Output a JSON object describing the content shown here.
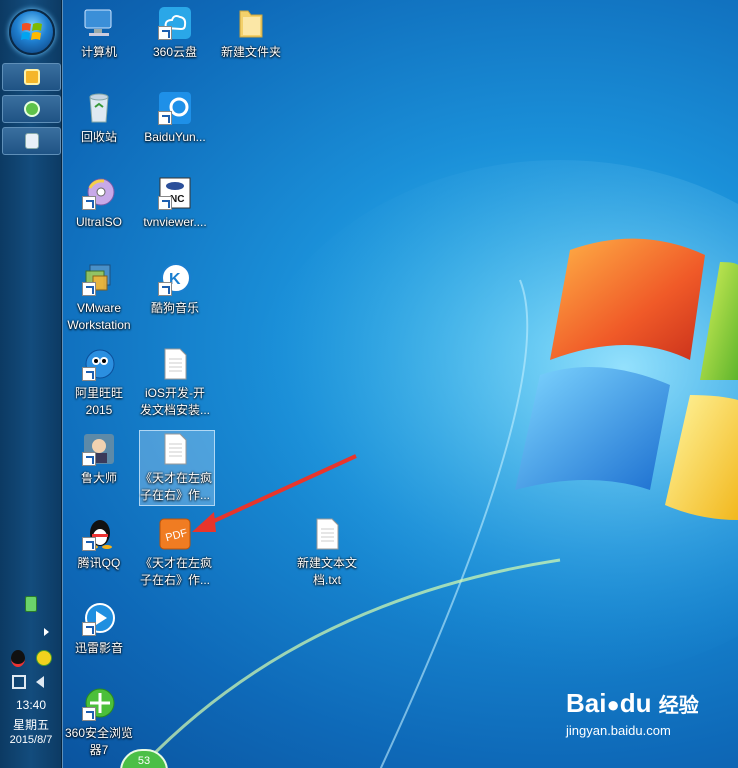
{
  "desktop": {
    "icons": [
      {
        "label": "计算机",
        "icon": "computer-icon"
      },
      {
        "label": "360云盘",
        "icon": "cloud-drive-icon"
      },
      {
        "label": "新建文件夹",
        "icon": "folder-icon"
      },
      {
        "label": "回收站",
        "icon": "recycle-bin-icon"
      },
      {
        "label": "BaiduYun...",
        "icon": "baiduyun-icon"
      },
      {
        "label": "UltraISO",
        "icon": "disc-icon"
      },
      {
        "label": "tvnviewer....",
        "icon": "vnc-viewer-icon"
      },
      {
        "label": "VMware",
        "label2": "Workstation",
        "icon": "vmware-icon"
      },
      {
        "label": "酷狗音乐",
        "icon": "kugou-icon"
      },
      {
        "label": "阿里旺旺",
        "label2": "2015",
        "icon": "aliwangwang-icon"
      },
      {
        "label": "iOS开发-开",
        "label2": "发文档安装...",
        "icon": "document-icon"
      },
      {
        "label": "鲁大师",
        "icon": "ludashi-icon"
      },
      {
        "label": "《天才在左疯",
        "label2": "子在右》作...",
        "icon": "document-icon"
      },
      {
        "label": "腾讯QQ",
        "icon": "qq-icon"
      },
      {
        "label": "《天才在左疯",
        "label2": "子在右》作...",
        "icon": "pdf-icon",
        "pdf_text": "PDF"
      },
      {
        "label": "新建文本文",
        "label2": "档.txt",
        "icon": "text-file-icon"
      },
      {
        "label": "迅雷影音",
        "icon": "xunlei-player-icon"
      },
      {
        "label": "360安全浏览",
        "label2": "器7",
        "icon": "360-browser-icon"
      }
    ]
  },
  "taskbar": {
    "clock": {
      "time": "13:40",
      "weekday": "星期五",
      "date": "2015/8/7"
    },
    "badge": "53"
  },
  "watermark": {
    "brand": "Bai",
    "brand2": "du",
    "suffix": "经验",
    "url": "jingyan.baidu.com"
  }
}
